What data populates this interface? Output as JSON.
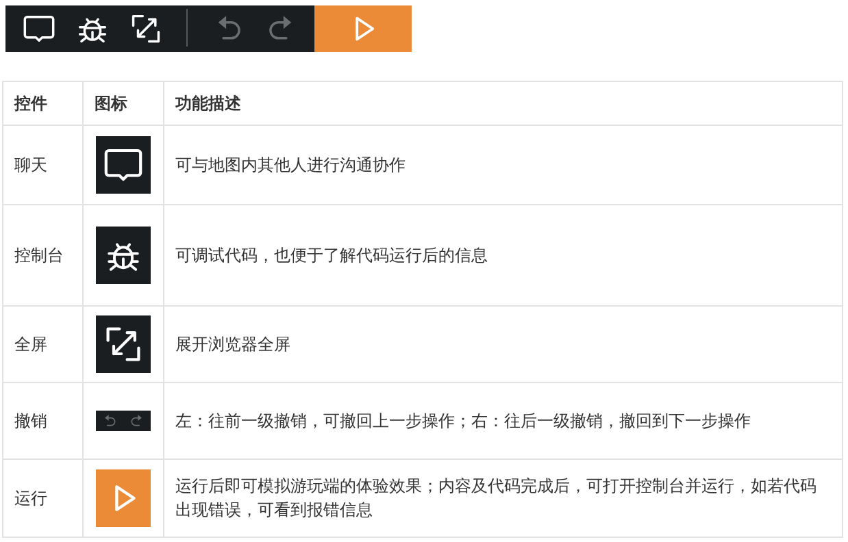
{
  "toolbar": {
    "buttons": [
      {
        "kind": "chat",
        "disabled": false
      },
      {
        "kind": "bug",
        "disabled": false
      },
      {
        "kind": "fullscreen",
        "disabled": false
      },
      {
        "kind": "separator"
      },
      {
        "kind": "undo",
        "disabled": true
      },
      {
        "kind": "redo",
        "disabled": true
      },
      {
        "kind": "run",
        "disabled": false
      }
    ]
  },
  "table": {
    "columns": [
      "控件",
      "图标",
      "功能描述"
    ],
    "rows": [
      {
        "control": "聊天",
        "kind": "chat",
        "description": "可与地图内其他人进行沟通协作"
      },
      {
        "control": "控制台",
        "kind": "bug",
        "description": "可调试代码，也便于了解代码运行后的信息"
      },
      {
        "control": "全屏",
        "kind": "fullscreen",
        "description": "展开浏览器全屏"
      },
      {
        "control": "撤销",
        "kind": "undo_redo",
        "description": "左：往前一级撤销，可撤回上一步操作；右：往后一级撤销，撤回到下一步操作"
      },
      {
        "control": "运行",
        "kind": "run",
        "description": "运行后即可模拟游玩端的体验效果；内容及代码完成后，可打开控制台并运行，如若代码出现错误，可看到报错信息"
      }
    ]
  }
}
